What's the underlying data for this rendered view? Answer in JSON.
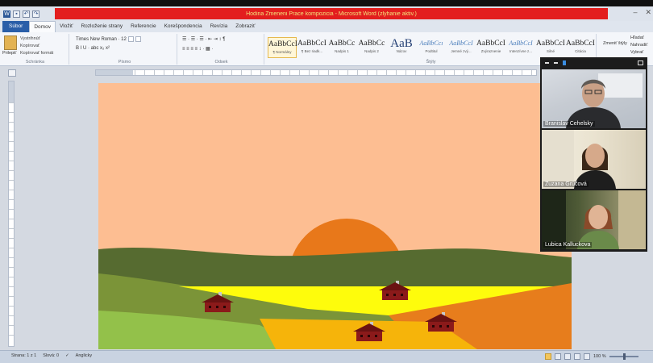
{
  "window": {
    "title": "Hodina Zmeneni Prace kompozicia - Microsoft Word (zlyhanie aktiv.)",
    "controls": [
      "–",
      "✕"
    ]
  },
  "quick_access": {
    "word_icon": "W",
    "save_icon": "save-icon",
    "undo_icon": "undo-icon"
  },
  "tabs": [
    {
      "label": "Súbor",
      "kind": "file"
    },
    {
      "label": "Domov",
      "kind": "active"
    },
    {
      "label": "Vložiť",
      "kind": ""
    },
    {
      "label": "Rozloženie strany",
      "kind": ""
    },
    {
      "label": "Referencie",
      "kind": ""
    },
    {
      "label": "Korešpondencia",
      "kind": ""
    },
    {
      "label": "Revízia",
      "kind": ""
    },
    {
      "label": "Zobraziť",
      "kind": ""
    }
  ],
  "ribbon": {
    "clipboard": {
      "paste": "Prilepiť",
      "items": [
        "Vystrihnúť",
        "Kopírovať",
        "Kopírovať formát"
      ],
      "group": "Schránka"
    },
    "font": {
      "name": "Times New Roman",
      "size": "12",
      "row2": "B I U · abc x₂ x²",
      "group": "Písmo"
    },
    "paragraph": {
      "row1": "☰ · ☰ · ☰ ·  ⇤ ⇥  ↕ ¶",
      "row2": "≡ ≡ ≡ ≡  ↕ · ▦ ·",
      "group": "Odsek"
    },
    "styles": {
      "items": [
        {
          "sample": "AaBbCcI",
          "name": "¶ Normálny",
          "kind": "sel"
        },
        {
          "sample": "AaBbCcI",
          "name": "¶ Bez riadk...",
          "kind": ""
        },
        {
          "sample": "AaBbCc",
          "name": "Nadpis 1",
          "kind": ""
        },
        {
          "sample": "AaBbCc",
          "name": "Nadpis 2",
          "kind": ""
        },
        {
          "sample": "AaB",
          "name": "Názov",
          "kind": "big"
        },
        {
          "sample": "AaBbCcı",
          "name": "Podtitul",
          "kind": "blue"
        },
        {
          "sample": "AaBbCcI",
          "name": "Jemné zvý...",
          "kind": "blue"
        },
        {
          "sample": "AaBbCcI",
          "name": "Zvýraznenie",
          "kind": ""
        },
        {
          "sample": "AaBbCcI",
          "name": "Intenzívne z...",
          "kind": "blue"
        },
        {
          "sample": "AaBbCcI",
          "name": "Silné",
          "kind": ""
        },
        {
          "sample": "AaBbCcI",
          "name": "Citácia",
          "kind": ""
        }
      ],
      "change_styles": "Zmeniť štýly",
      "group": "Štýly"
    },
    "editing": {
      "find": "Hľadať",
      "replace": "Nahradiť",
      "select": "Vybrať"
    }
  },
  "participants": [
    {
      "name": "Branislav Cehelsky"
    },
    {
      "name": "Zuzana Grúčová"
    },
    {
      "name": "Lubica Kalluckova"
    }
  ],
  "status": {
    "page": "Strana: 1 z 1",
    "words": "Slová: 0",
    "language": "Anglicky",
    "zoom": "100 %"
  },
  "colors": {
    "sky": "#fdbe92",
    "sun": "#e8781a",
    "dark_hill": "#566b30",
    "mid_hill": "#7b9438",
    "light_green": "#93c14a",
    "yellow_field": "#fefc0c",
    "orange_field": "#e77d1c",
    "amber_field": "#f6b40a",
    "house": "#8b1a1a",
    "roof": "#6a1212",
    "chimney": "#c9c9c9"
  }
}
